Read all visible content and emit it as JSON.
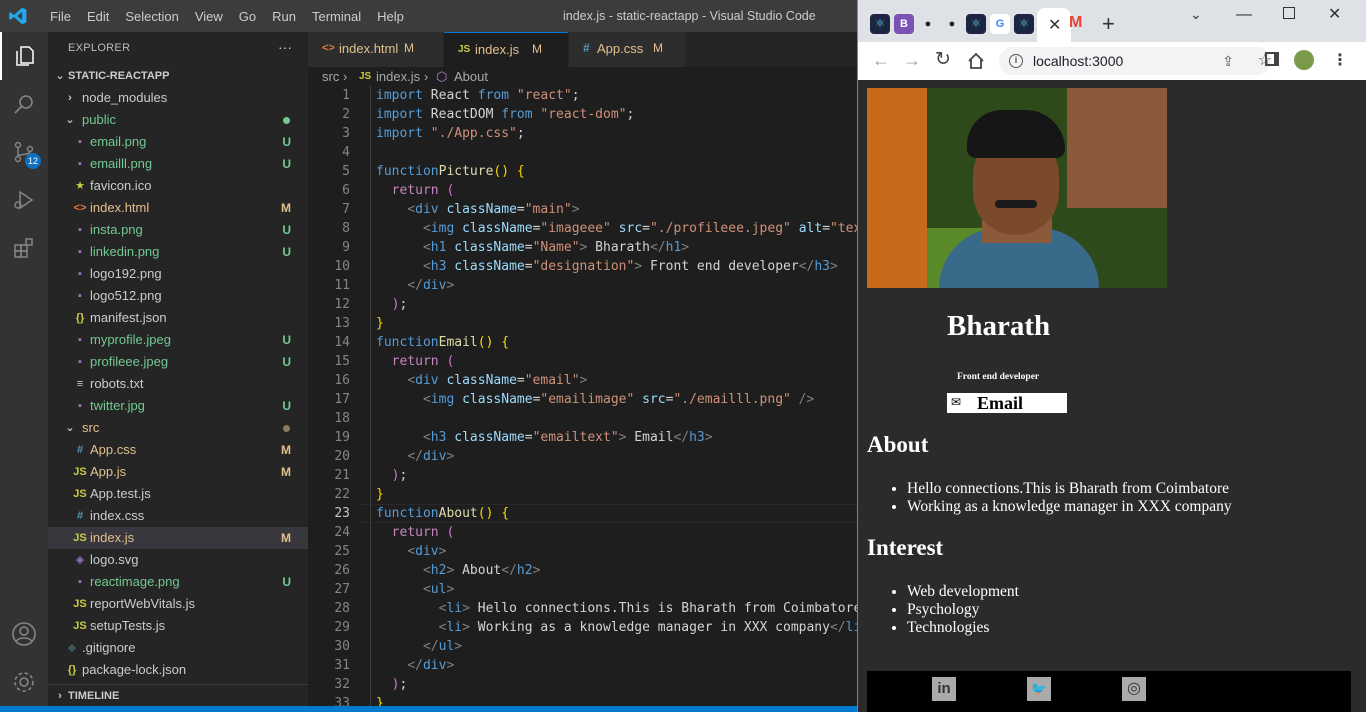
{
  "vscode": {
    "menu": [
      "File",
      "Edit",
      "Selection",
      "View",
      "Go",
      "Run",
      "Terminal",
      "Help"
    ],
    "title": "index.js - static-reactapp - Visual Studio Code",
    "scm_badge": "12",
    "explorer": {
      "header": "EXPLORER",
      "more": "···",
      "project": "STATIC-REACTAPP",
      "timeline": "TIMELINE"
    },
    "tree": [
      {
        "n": "node_modules",
        "d": 0,
        "t": "folder",
        "o": false,
        "c": "#ccc"
      },
      {
        "n": "public",
        "d": 0,
        "t": "folder",
        "o": true,
        "c": "#73c991",
        "dot": "#73c991"
      },
      {
        "n": "email.png",
        "d": 1,
        "t": "img",
        "c": "#73c991",
        "s": "U"
      },
      {
        "n": "emailll.png",
        "d": 1,
        "t": "img",
        "c": "#73c991",
        "s": "U"
      },
      {
        "n": "favicon.ico",
        "d": 1,
        "t": "star",
        "c": "#ccc"
      },
      {
        "n": "index.html",
        "d": 1,
        "t": "html",
        "c": "#e2c08d",
        "s": "M"
      },
      {
        "n": "insta.png",
        "d": 1,
        "t": "img",
        "c": "#73c991",
        "s": "U"
      },
      {
        "n": "linkedin.png",
        "d": 1,
        "t": "img",
        "c": "#73c991",
        "s": "U"
      },
      {
        "n": "logo192.png",
        "d": 1,
        "t": "img",
        "c": "#ccc"
      },
      {
        "n": "logo512.png",
        "d": 1,
        "t": "img",
        "c": "#ccc"
      },
      {
        "n": "manifest.json",
        "d": 1,
        "t": "json",
        "c": "#ccc"
      },
      {
        "n": "myprofile.jpeg",
        "d": 1,
        "t": "img",
        "c": "#73c991",
        "s": "U"
      },
      {
        "n": "profileee.jpeg",
        "d": 1,
        "t": "img",
        "c": "#73c991",
        "s": "U"
      },
      {
        "n": "robots.txt",
        "d": 1,
        "t": "txt",
        "c": "#ccc"
      },
      {
        "n": "twitter.jpg",
        "d": 1,
        "t": "img",
        "c": "#73c991",
        "s": "U"
      },
      {
        "n": "src",
        "d": 0,
        "t": "folder",
        "o": true,
        "c": "#e2c08d",
        "dot": "#8a7a5a"
      },
      {
        "n": "App.css",
        "d": 1,
        "t": "css",
        "c": "#e2c08d",
        "s": "M"
      },
      {
        "n": "App.js",
        "d": 1,
        "t": "js",
        "c": "#e2c08d",
        "s": "M"
      },
      {
        "n": "App.test.js",
        "d": 1,
        "t": "js",
        "c": "#ccc"
      },
      {
        "n": "index.css",
        "d": 1,
        "t": "css",
        "c": "#ccc"
      },
      {
        "n": "index.js",
        "d": 1,
        "t": "js",
        "c": "#e2c08d",
        "s": "M",
        "sel": true
      },
      {
        "n": "logo.svg",
        "d": 1,
        "t": "svg",
        "c": "#ccc"
      },
      {
        "n": "reactimage.png",
        "d": 1,
        "t": "img",
        "c": "#73c991",
        "s": "U"
      },
      {
        "n": "reportWebVitals.js",
        "d": 1,
        "t": "js",
        "c": "#ccc"
      },
      {
        "n": "setupTests.js",
        "d": 1,
        "t": "js",
        "c": "#ccc"
      },
      {
        "n": ".gitignore",
        "d": 0,
        "t": "git",
        "c": "#ccc"
      },
      {
        "n": "package-lock.json",
        "d": 0,
        "t": "json",
        "c": "#ccc"
      }
    ],
    "tabs": [
      {
        "icon": "<>",
        "icon_color": "#e37933",
        "label": "index.html",
        "status": "M",
        "active": false
      },
      {
        "icon": "JS",
        "icon_color": "#cbcb41",
        "label": "index.js",
        "status": "M",
        "active": true
      },
      {
        "icon": "#",
        "icon_color": "#519aba",
        "label": "App.css",
        "status": "M",
        "active": false
      }
    ],
    "breadcrumb": {
      "folder": "src",
      "file_icon": "JS",
      "file": "index.js",
      "symbol": "About"
    },
    "code": [
      [
        [
          "kw",
          "import"
        ],
        [
          "",
          "React"
        ],
        [
          "kw",
          "from"
        ],
        [
          "str",
          "\"react\""
        ],
        [
          "",
          ";"
        ]
      ],
      [
        [
          "kw",
          "import"
        ],
        [
          "",
          "ReactDOM"
        ],
        [
          "kw",
          "from"
        ],
        [
          "str",
          "\"react-dom\""
        ],
        [
          "",
          ";"
        ]
      ],
      [
        [
          "kw",
          "import"
        ],
        [
          "str",
          "\"./App.css\""
        ],
        [
          "",
          ";"
        ]
      ],
      [],
      [
        [
          "kw",
          "function"
        ],
        [
          "fn",
          "Picture"
        ],
        [
          "yb",
          "()"
        ],
        [
          "",
          ""
        ],
        [
          "yb",
          "{"
        ]
      ],
      [
        [
          "  ",
          ""
        ],
        [
          "pp",
          "return"
        ],
        [
          "pb",
          "("
        ]
      ],
      [
        [
          "    ",
          ""
        ],
        [
          "br",
          "<"
        ],
        [
          "tg",
          "div"
        ],
        [
          "at",
          "className"
        ],
        [
          "",
          "="
        ],
        [
          "str",
          "\"main\""
        ],
        [
          "br",
          ">"
        ]
      ],
      [
        [
          "      ",
          ""
        ],
        [
          "br",
          "<"
        ],
        [
          "tg",
          "img"
        ],
        [
          "at",
          "className"
        ],
        [
          "",
          "="
        ],
        [
          "str",
          "\"imageee\""
        ],
        [
          "at",
          "src"
        ],
        [
          "",
          "="
        ],
        [
          "str",
          "\"./profileee.jpeg\""
        ],
        [
          "at",
          "alt"
        ],
        [
          "",
          "="
        ],
        [
          "str",
          "\"text"
        ]
      ],
      [
        [
          "      ",
          ""
        ],
        [
          "br",
          "<"
        ],
        [
          "tg",
          "h1"
        ],
        [
          "at",
          "className"
        ],
        [
          "",
          "="
        ],
        [
          "str",
          "\"Name\""
        ],
        [
          "br",
          ">"
        ],
        [
          "",
          "Bharath"
        ],
        [
          "br",
          "</"
        ],
        [
          "tg",
          "h1"
        ],
        [
          "br",
          ">"
        ]
      ],
      [
        [
          "      ",
          ""
        ],
        [
          "br",
          "<"
        ],
        [
          "tg",
          "h3"
        ],
        [
          "at",
          "className"
        ],
        [
          "",
          "="
        ],
        [
          "str",
          "\"designation\""
        ],
        [
          "br",
          ">"
        ],
        [
          "",
          "Front end developer"
        ],
        [
          "br",
          "</"
        ],
        [
          "tg",
          "h3"
        ],
        [
          "br",
          ">"
        ]
      ],
      [
        [
          "    ",
          ""
        ],
        [
          "br",
          "</"
        ],
        [
          "tg",
          "div"
        ],
        [
          "br",
          ">"
        ]
      ],
      [
        [
          "  ",
          ""
        ],
        [
          "pb",
          ")"
        ],
        [
          "",
          ";"
        ]
      ],
      [
        [
          "yb",
          "}"
        ]
      ],
      [
        [
          "kw",
          "function"
        ],
        [
          "fn",
          "Email"
        ],
        [
          "yb",
          "()"
        ],
        [
          "yb",
          "{"
        ]
      ],
      [
        [
          "  ",
          ""
        ],
        [
          "pp",
          "return"
        ],
        [
          "pb",
          "("
        ]
      ],
      [
        [
          "    ",
          ""
        ],
        [
          "br",
          "<"
        ],
        [
          "tg",
          "div"
        ],
        [
          "at",
          "className"
        ],
        [
          "",
          "="
        ],
        [
          "str",
          "\"email\""
        ],
        [
          "br",
          ">"
        ]
      ],
      [
        [
          "      ",
          ""
        ],
        [
          "br",
          "<"
        ],
        [
          "tg",
          "img"
        ],
        [
          "at",
          "className"
        ],
        [
          "",
          "="
        ],
        [
          "str",
          "\"emailimage\""
        ],
        [
          "at",
          "src"
        ],
        [
          "",
          "="
        ],
        [
          "str",
          "\"./emailll.png\""
        ],
        [
          "br",
          "/>"
        ]
      ],
      [],
      [
        [
          "      ",
          ""
        ],
        [
          "br",
          "<"
        ],
        [
          "tg",
          "h3"
        ],
        [
          "at",
          "className"
        ],
        [
          "",
          "="
        ],
        [
          "str",
          "\"emailtext\""
        ],
        [
          "br",
          ">"
        ],
        [
          "",
          "Email"
        ],
        [
          "br",
          "</"
        ],
        [
          "tg",
          "h3"
        ],
        [
          "br",
          ">"
        ]
      ],
      [
        [
          "    ",
          ""
        ],
        [
          "br",
          "</"
        ],
        [
          "tg",
          "div"
        ],
        [
          "br",
          ">"
        ]
      ],
      [
        [
          "  ",
          ""
        ],
        [
          "pb",
          ")"
        ],
        [
          "",
          ";"
        ]
      ],
      [
        [
          "yb",
          "}"
        ]
      ],
      [
        [
          "kw",
          "function"
        ],
        [
          "fn",
          "About"
        ],
        [
          "yb",
          "()"
        ],
        [
          "yb",
          "{"
        ]
      ],
      [
        [
          "  ",
          ""
        ],
        [
          "pp",
          "return"
        ],
        [
          "pb",
          "("
        ]
      ],
      [
        [
          "    ",
          ""
        ],
        [
          "br",
          "<"
        ],
        [
          "tg",
          "div"
        ],
        [
          "br",
          ">"
        ]
      ],
      [
        [
          "      ",
          ""
        ],
        [
          "br",
          "<"
        ],
        [
          "tg",
          "h2"
        ],
        [
          "br",
          ">"
        ],
        [
          "",
          "About"
        ],
        [
          "br",
          "</"
        ],
        [
          "tg",
          "h2"
        ],
        [
          "br",
          ">"
        ]
      ],
      [
        [
          "      ",
          ""
        ],
        [
          "br",
          "<"
        ],
        [
          "tg",
          "ul"
        ],
        [
          "br",
          ">"
        ]
      ],
      [
        [
          "        ",
          ""
        ],
        [
          "br",
          "<"
        ],
        [
          "tg",
          "li"
        ],
        [
          "br",
          ">"
        ],
        [
          "",
          "Hello connections.This is Bharath from Coimbatore"
        ],
        [
          "br",
          "</"
        ]
      ],
      [
        [
          "        ",
          ""
        ],
        [
          "br",
          "<"
        ],
        [
          "tg",
          "li"
        ],
        [
          "br",
          ">"
        ],
        [
          "",
          "Working as a knowledge manager in XXX company"
        ],
        [
          "br",
          "</"
        ],
        [
          "tg",
          "li"
        ],
        [
          "br",
          ">"
        ]
      ],
      [
        [
          "      ",
          ""
        ],
        [
          "br",
          "</"
        ],
        [
          "tg",
          "ul"
        ],
        [
          "br",
          ">"
        ]
      ],
      [
        [
          "    ",
          ""
        ],
        [
          "br",
          "</"
        ],
        [
          "tg",
          "div"
        ],
        [
          "br",
          ">"
        ]
      ],
      [
        [
          "  ",
          ""
        ],
        [
          "pb",
          ")"
        ],
        [
          "",
          ";"
        ]
      ],
      [
        [
          "yb",
          "}"
        ]
      ]
    ]
  },
  "browser": {
    "tab_icons": [
      {
        "icon": "react-icon",
        "char": "⚛",
        "bg": "#1b2540",
        "fg": "#61dafb"
      },
      {
        "icon": "bootstrap-icon",
        "char": "B",
        "bg": "#7952b3",
        "fg": "#fff"
      },
      {
        "icon": "github-icon",
        "char": "●",
        "bg": "#dee1e6",
        "fg": "#222"
      },
      {
        "icon": "github-icon",
        "char": "●",
        "bg": "#dee1e6",
        "fg": "#222"
      },
      {
        "icon": "react-icon",
        "char": "⚛",
        "bg": "#1b2540",
        "fg": "#61dafb"
      },
      {
        "icon": "google-icon",
        "char": "G",
        "bg": "#fff",
        "fg": "#4285f4"
      },
      {
        "icon": "react-icon",
        "char": "⚛",
        "bg": "#1b2540",
        "fg": "#61dafb"
      }
    ],
    "url": "localhost:3000",
    "page": {
      "name": "Bharath",
      "designation": "Front end developer",
      "email_label": "Email",
      "about_heading": "About",
      "about_items": [
        "Hello connections.This is Bharath from Coimbatore",
        "Working as a knowledge manager in XXX company"
      ],
      "interest_heading": "Interest",
      "interest_items": [
        "Web development",
        "Psychology",
        "Technologies"
      ],
      "social": [
        "in",
        "🐦",
        "◎"
      ]
    }
  }
}
